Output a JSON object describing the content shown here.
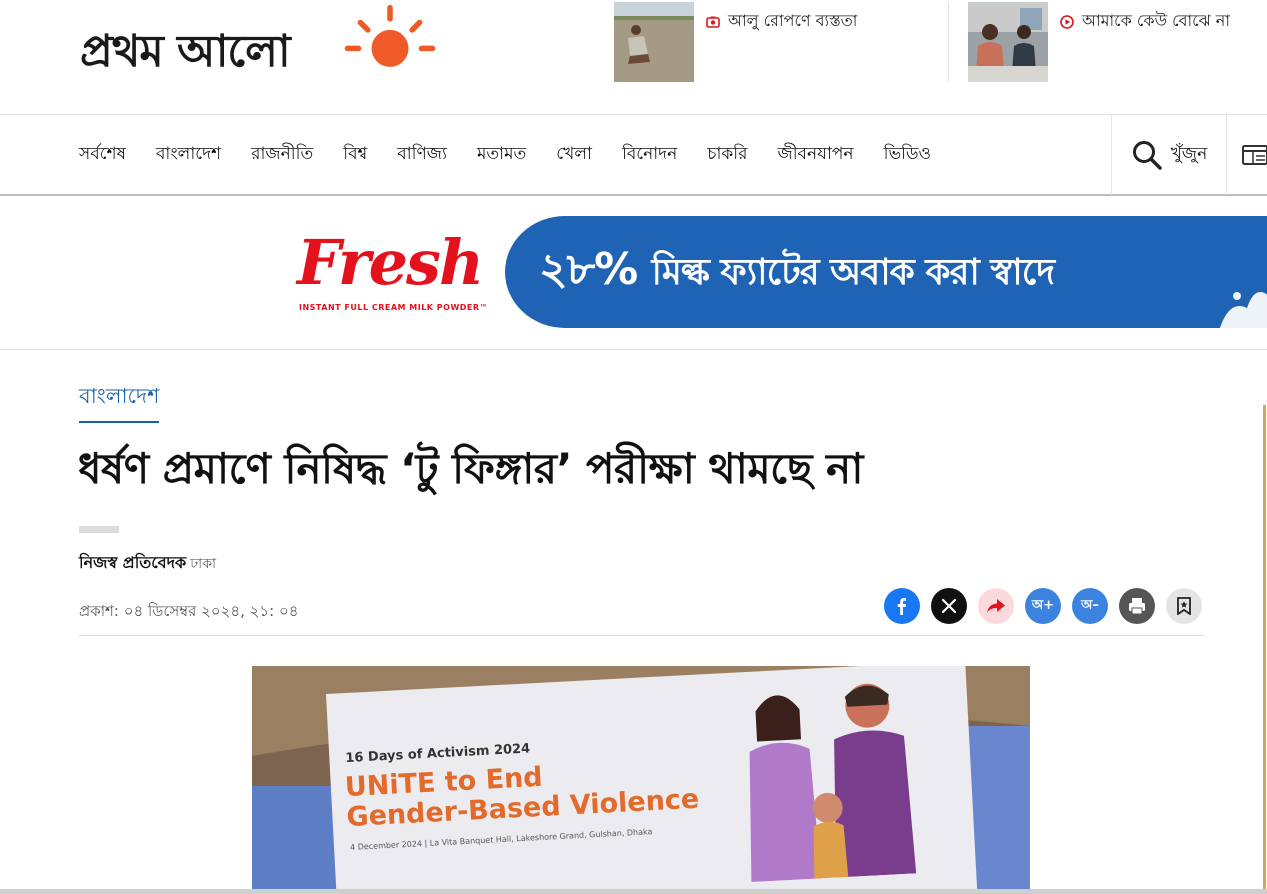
{
  "logo": {
    "text": "প্রথম আলো"
  },
  "promos": [
    {
      "title": "আলু রোপণে ব্যস্ততা",
      "icon": "camera-icon",
      "icon_color": "#e0141e"
    },
    {
      "title": "আমাকে কেউ বোঝে না",
      "icon": "play-icon",
      "icon_color": "#e0141e"
    }
  ],
  "nav": {
    "items": [
      "সর্বশেষ",
      "বাংলাদেশ",
      "রাজনীতি",
      "বিশ্ব",
      "বাণিজ্য",
      "মতামত",
      "খেলা",
      "বিনোদন",
      "চাকরি",
      "জীবনযাপন",
      "ভিডিও"
    ],
    "search_label": "খুঁজুন"
  },
  "ad": {
    "brand": "Fresh",
    "sub": "INSTANT FULL CREAM MILK POWDER™",
    "copy_number": "২৮%",
    "copy_text": "মিল্ক ফ্যাটের অবাক করা স্বাদে",
    "brand_color": "#e3121d",
    "panel_color": "#1f63b4"
  },
  "article": {
    "category": "বাংলাদেশ",
    "headline": "ধর্ষণ প্রমাণে নিষিদ্ধ ‘টু ফিঙ্গার’ পরীক্ষা থামছে না",
    "author": "নিজস্ব প্রতিবেদক",
    "location": "ঢাকা",
    "published": "প্রকাশ: ০৪ ডিসেম্বর ২০২৪, ২১: ০৪",
    "share_font_plus": "অ+",
    "share_font_minus": "অ–"
  },
  "hero": {
    "line1": "16 Days of Activism 2024",
    "line2": "UNiTE to End",
    "line3": "Gender-Based Violence",
    "line4": "4 December 2024 | La Vita Banquet Hall, Lakeshore Grand, Gulshan, Dhaka"
  }
}
